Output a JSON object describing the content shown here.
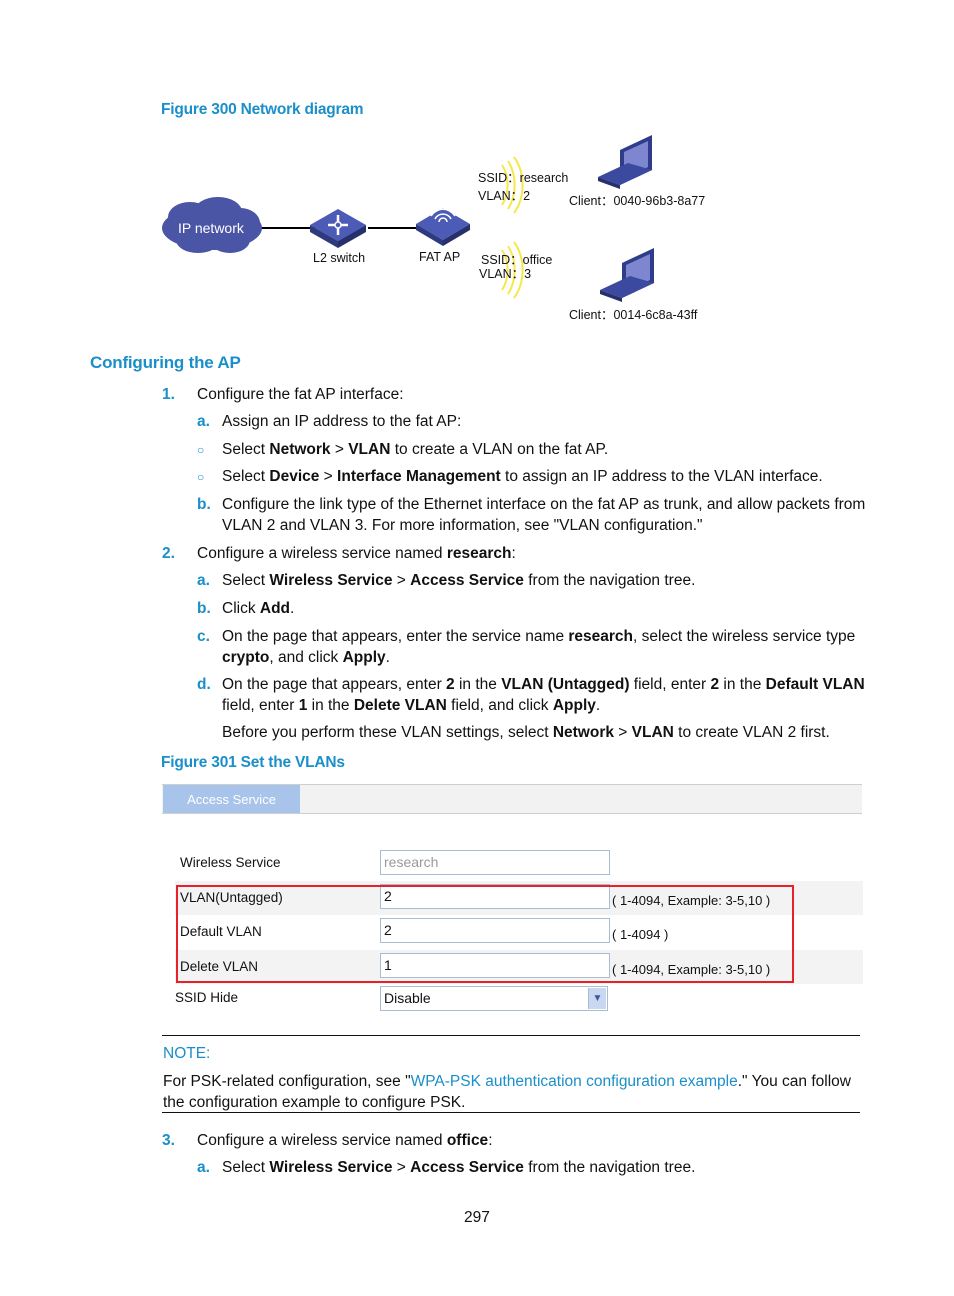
{
  "figure300": {
    "caption": "Figure 300 Network diagram",
    "nodes": {
      "cloud": "IP network",
      "switch": "L2 switch",
      "ap": "FAT AP"
    },
    "wlan1": {
      "ssid": "SSID：research",
      "vlan": "VLAN：2",
      "client": "Client：0040-96b3-8a77"
    },
    "wlan2": {
      "ssid": "SSID：office",
      "vlan": "VLAN：3",
      "client": "Client：0014-6c8a-43ff"
    },
    "colors": {
      "device": "#3b4a9e",
      "cloud": "#4a55a8",
      "waves": "#f5e53a"
    }
  },
  "section": {
    "title": "Configuring the AP"
  },
  "steps": {
    "s1": {
      "num": "1.",
      "text": "Configure the fat AP interface:",
      "a": {
        "letter": "a.",
        "text": "Assign an IP address to the fat AP:"
      },
      "bul1": {
        "pre": "Select ",
        "b1": "Network",
        "sep": " > ",
        "b2": "VLAN",
        "post": " to create a VLAN on the fat AP."
      },
      "bul2": {
        "pre": "Select ",
        "b1": "Device",
        "sep": " > ",
        "b2": "Interface Management",
        "post": " to assign an IP address to the VLAN interface."
      },
      "b": {
        "letter": "b.",
        "text": "Configure the link type of the Ethernet interface on the fat AP as trunk, and allow packets from VLAN 2 and VLAN 3. For more information, see \"VLAN configuration.\""
      }
    },
    "s2": {
      "num": "2.",
      "pre": "Configure a wireless service named ",
      "bold": "research",
      "post": ":",
      "a": {
        "letter": "a.",
        "pre": "Select ",
        "b1": "Wireless Service",
        "sep": " > ",
        "b2": "Access Service",
        "post": " from the navigation tree."
      },
      "b": {
        "letter": "b.",
        "pre": "Click ",
        "b1": "Add",
        "post": "."
      },
      "c": {
        "letter": "c.",
        "t1": "On the page that appears, enter the service name ",
        "b1": "research",
        "t2": ", select the wireless service type ",
        "b2": "crypto",
        "t3": ", and click ",
        "b3": "Apply",
        "t4": "."
      },
      "d": {
        "letter": "d.",
        "t1": "On the page that appears, enter ",
        "b1": "2",
        "t2": " in the ",
        "b2": "VLAN (Untagged)",
        "t3": " field, enter ",
        "b3": "2",
        "t4": " in the ",
        "b4": "Default VLAN",
        "t5": " field, enter ",
        "b5": "1",
        "t6": " in the ",
        "b6": "Delete VLAN",
        "t7": " field, and click ",
        "b7": "Apply",
        "t8": "."
      },
      "d_note": {
        "t1": "Before you perform these VLAN settings, select ",
        "b1": "Network",
        "t2": " > ",
        "b2": "VLAN",
        "t3": " to create VLAN 2 first."
      }
    },
    "s3": {
      "num": "3.",
      "pre": "Configure a wireless service named ",
      "bold": "office",
      "post": ":",
      "a": {
        "letter": "a.",
        "pre": "Select ",
        "b1": "Wireless Service",
        "sep": " > ",
        "b2": "Access Service",
        "post": " from the navigation tree."
      }
    }
  },
  "figure301": {
    "caption": "Figure 301 Set the VLANs",
    "tab": "Access Service",
    "fields": [
      {
        "label": "Wireless Service",
        "value": "research",
        "hint": ""
      },
      {
        "label": "VLAN(Untagged)",
        "value": "2",
        "hint": "( 1-4094, Example: 3-5,10 )"
      },
      {
        "label": "Default VLAN",
        "value": "2",
        "hint": "( 1-4094 )"
      },
      {
        "label": "Delete VLAN",
        "value": "1",
        "hint": "( 1-4094, Example: 3-5,10 )"
      },
      {
        "label": "SSID Hide",
        "value": "Disable",
        "hint": ""
      }
    ]
  },
  "note": {
    "title": "NOTE:",
    "t1": "For PSK-related configuration, see \"",
    "link": "WPA-PSK authentication configuration example",
    "t2": ".\" You can follow the configuration example to configure PSK."
  },
  "page_number": "297"
}
